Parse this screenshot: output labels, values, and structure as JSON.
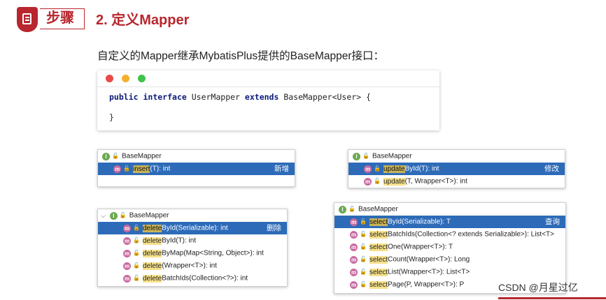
{
  "header": {
    "step_label": "步骤",
    "title": "2.  定义Mapper"
  },
  "description": "自定义的Mapper继承MybatisPlus提供的BaseMapper接口：",
  "code": {
    "kw1": "public",
    "kw2": "interface",
    "name": "UserMapper",
    "kw3": "extends",
    "rest": "BaseMapper<User> {",
    "close": "}",
    "dots": [
      "#e84a4a",
      "#f2b02c",
      "#3fc24a"
    ]
  },
  "popup_insert": {
    "title": "BaseMapper",
    "rows": [
      {
        "hl": "insert",
        "rest": "(T): int",
        "tag": "新增"
      }
    ]
  },
  "popup_update": {
    "title": "BaseMapper",
    "rows": [
      {
        "hl": "update",
        "rest": "ById(T): int",
        "tag": "修改"
      },
      {
        "hl": "update",
        "rest": "(T, Wrapper<T>): int"
      }
    ]
  },
  "popup_delete": {
    "title": "BaseMapper",
    "rows": [
      {
        "hl": "delete",
        "rest": "ById(Serializable): int",
        "tag": "删除"
      },
      {
        "hl": "delete",
        "rest": "ById(T): int"
      },
      {
        "hl": "delete",
        "rest": "ByMap(Map<String, Object>): int"
      },
      {
        "hl": "delete",
        "rest": "(Wrapper<T>): int"
      },
      {
        "hl": "delete",
        "rest": "BatchIds(Collection<?>): int"
      }
    ]
  },
  "popup_select": {
    "title": "BaseMapper",
    "rows": [
      {
        "hl": "select",
        "rest": "ById(Serializable): T",
        "tag": "查询"
      },
      {
        "hl": "select",
        "rest": "BatchIds(Collection<? extends Serializable>): List<T>"
      },
      {
        "hl": "select",
        "rest": "One(Wrapper<T>): T"
      },
      {
        "hl": "select",
        "rest": "Count(Wrapper<T>): Long"
      },
      {
        "hl": "select",
        "rest": "List(Wrapper<T>): List<T>"
      },
      {
        "hl": "select",
        "rest": "Page(P, Wrapper<T>): P"
      }
    ]
  },
  "icons": {
    "interface": "I",
    "method": "m",
    "lock": "🔓"
  },
  "watermark": "CSDN @月星过亿"
}
